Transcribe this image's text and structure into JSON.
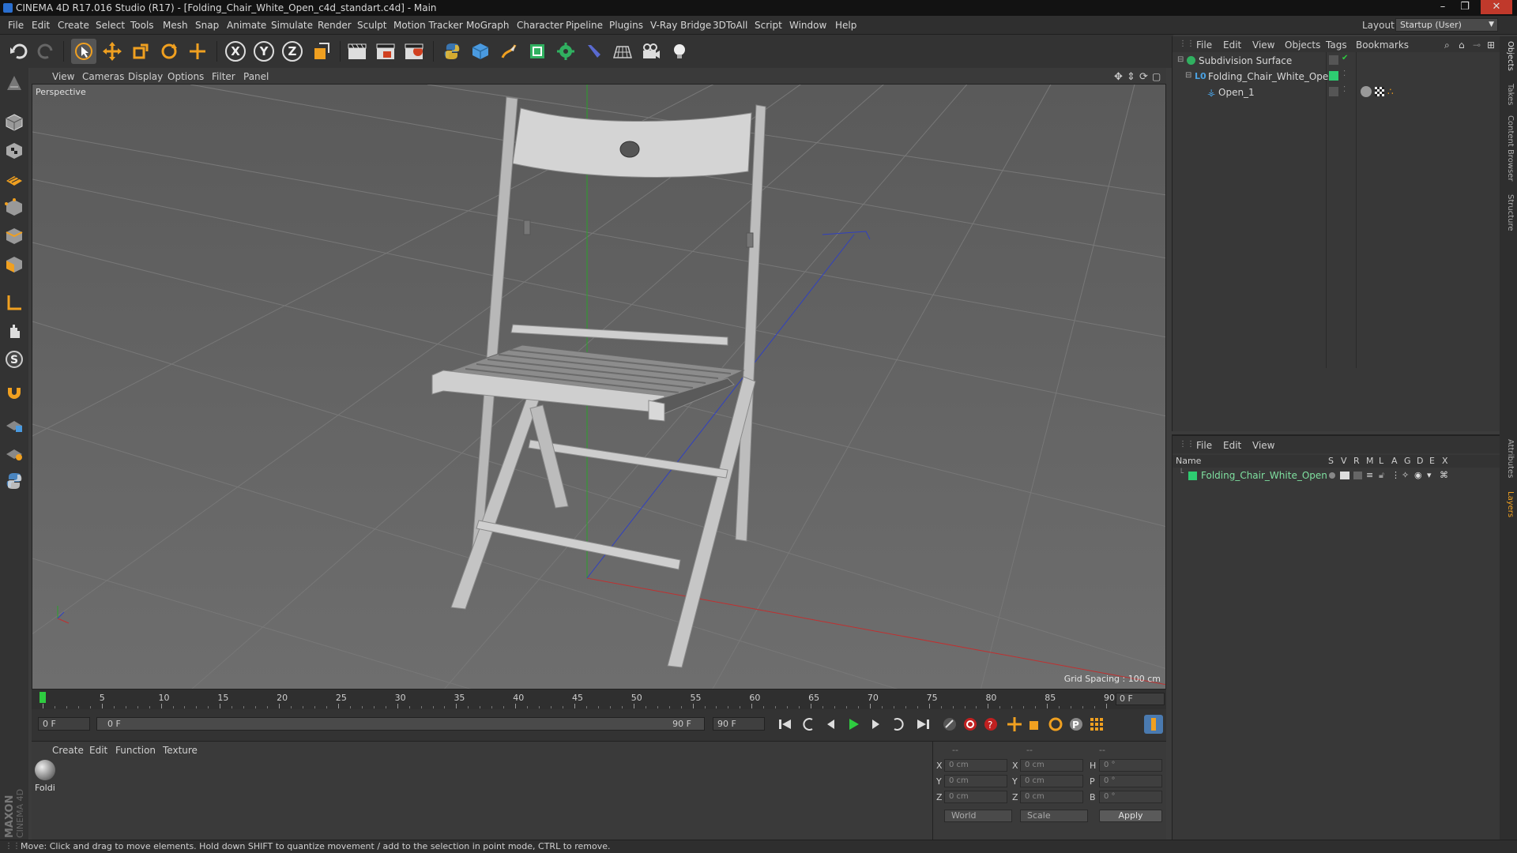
{
  "window": {
    "title": "CINEMA 4D R17.016 Studio (R17) - [Folding_Chair_White_Open_c4d_standart.c4d] - Main"
  },
  "menubar": {
    "items": [
      "File",
      "Edit",
      "Create",
      "Select",
      "Tools",
      "Mesh",
      "Snap",
      "Animate",
      "Simulate",
      "Render",
      "Sculpt",
      "Motion Tracker",
      "MoGraph",
      "Character",
      "Pipeline",
      "Plugins",
      "V-Ray Bridge",
      "3DToAll",
      "Script",
      "Window",
      "Help"
    ],
    "layout_label": "Layout:",
    "layout_value": "Startup (User)"
  },
  "toolbar": {
    "axis_x": "X",
    "axis_y": "Y",
    "axis_z": "Z"
  },
  "viewport": {
    "menu": [
      "View",
      "Cameras",
      "Display",
      "Options",
      "Filter",
      "Panel"
    ],
    "camera_label": "Perspective",
    "grid_spacing": "Grid Spacing : 100 cm"
  },
  "timeline": {
    "ticks": [
      "0",
      "5",
      "10",
      "15",
      "20",
      "25",
      "30",
      "35",
      "40",
      "45",
      "50",
      "55",
      "60",
      "65",
      "70",
      "75",
      "80",
      "85",
      "90"
    ],
    "current_frame": "0 F",
    "playhead_value": 0,
    "frame_max": 90
  },
  "playback": {
    "start_field": "0 F",
    "range_start": "0 F",
    "range_end": "90 F",
    "end_field": "90 F"
  },
  "material_panel": {
    "menu": [
      "Create",
      "Edit",
      "Function",
      "Texture"
    ],
    "material_name": "Foldi"
  },
  "coord_panel": {
    "headers": [
      "--",
      "--",
      "--"
    ],
    "rows": [
      {
        "l1": "X",
        "v1": "0 cm",
        "l2": "X",
        "v2": "0 cm",
        "l3": "H",
        "v3": "0 °"
      },
      {
        "l1": "Y",
        "v1": "0 cm",
        "l2": "Y",
        "v2": "0 cm",
        "l3": "P",
        "v3": "0 °"
      },
      {
        "l1": "Z",
        "v1": "0 cm",
        "l2": "Z",
        "v2": "0 cm",
        "l3": "B",
        "v3": "0 °"
      }
    ],
    "mode_world": "World",
    "mode_scale": "Scale",
    "apply_label": "Apply"
  },
  "objects_panel": {
    "menu": [
      "File",
      "Edit",
      "View",
      "Objects",
      "Tags",
      "Bookmarks"
    ],
    "objects": [
      {
        "name": "Subdivision Surface"
      },
      {
        "name": "Folding_Chair_White_Open"
      },
      {
        "name": "Open_1"
      }
    ]
  },
  "layers_panel": {
    "menu": [
      "File",
      "Edit",
      "View"
    ],
    "columns": [
      "Name",
      "S",
      "V",
      "R",
      "M",
      "L",
      "A",
      "G",
      "D",
      "E",
      "X"
    ],
    "layer_name": "Folding_Chair_White_Open",
    "layer_color": "#2ecc71"
  },
  "right_tabs": [
    "Objects",
    "Takes",
    "Content Browser",
    "Structure",
    "Attributes",
    "Layers"
  ],
  "status": {
    "text": "Move: Click and drag to move elements. Hold down SHIFT to quantize movement / add to the selection in point mode, CTRL to remove."
  },
  "brand": {
    "line1": "MAXON",
    "line2": "CINEMA 4D"
  }
}
